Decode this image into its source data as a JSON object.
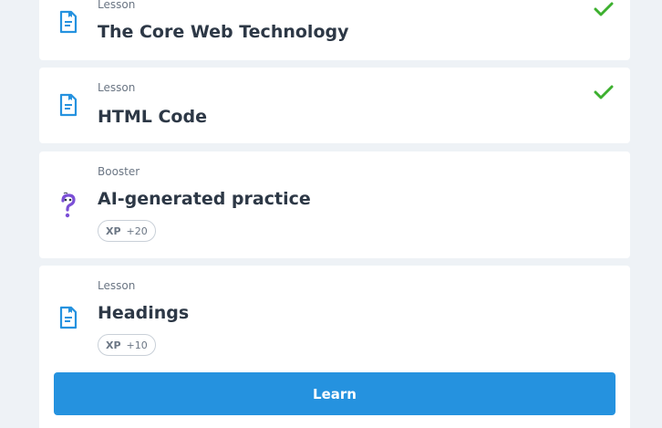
{
  "lessons": [
    {
      "type": "Lesson",
      "title": "The Core Web Technology",
      "completed": true,
      "icon": "lesson-doc-icon"
    },
    {
      "type": "Lesson",
      "title": "HTML Code",
      "completed": true,
      "icon": "lesson-doc-icon"
    },
    {
      "type": "Booster",
      "title": "AI-generated practice",
      "completed": false,
      "icon": "question-mark-icon",
      "xp_label": "XP",
      "xp_value": "+20"
    },
    {
      "type": "Lesson",
      "title": "Headings",
      "completed": false,
      "icon": "lesson-doc-icon",
      "xp_label": "XP",
      "xp_value": "+10"
    }
  ],
  "learn_button": {
    "label": "Learn"
  },
  "colors": {
    "accent": "#2592df",
    "check_green": "#3db02f",
    "booster_purple": "#7b4fd6",
    "background": "#eef2f6"
  }
}
